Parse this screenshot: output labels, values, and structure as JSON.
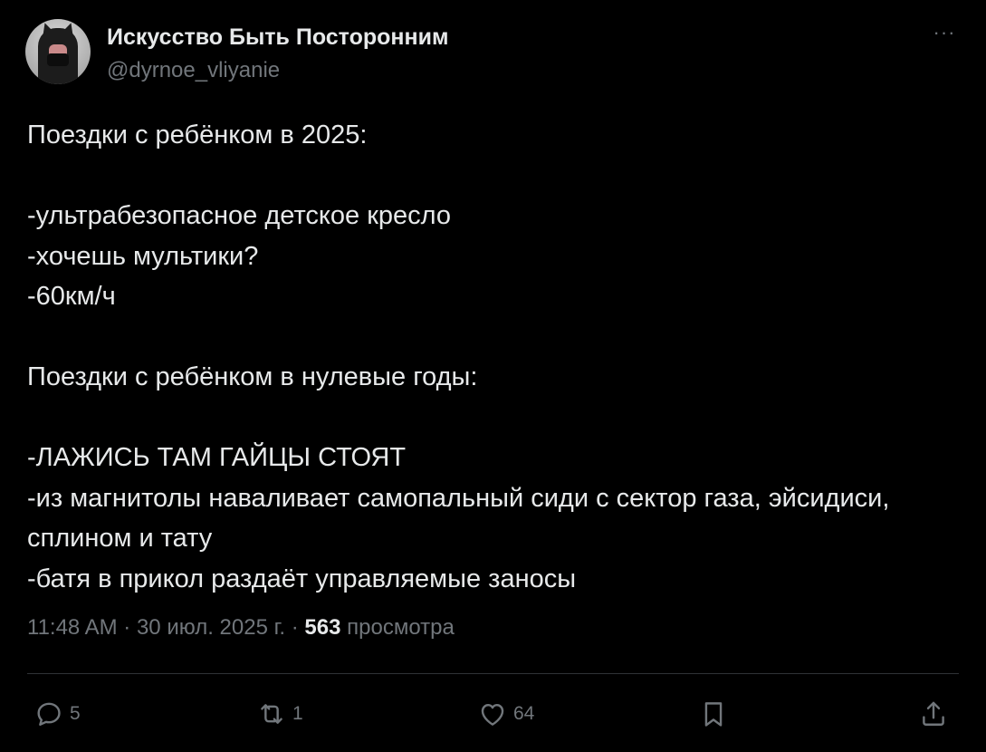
{
  "author": {
    "display_name": "Искусство Быть Посторонним",
    "handle": "@dyrnoe_vliyanie"
  },
  "more_icon": "more-horizontal-icon",
  "tweet_text": [
    "Поездки с ребёнком в 2025:",
    "",
    "-ультрабезопасное детское кресло",
    "-хочешь мультики?",
    "-60км/ч",
    "",
    "Поездки с ребёнком в нулевые годы:",
    "",
    "-ЛАЖИСЬ ТАМ ГАЙЦЫ СТОЯТ",
    "-из магнитолы наваливает самопальный сиди с сектор газа, эйсидиси,",
    "сплином и тату",
    "-батя в прикол раздаёт управляемые заносы"
  ],
  "meta": {
    "time": "11:48 AM",
    "separator": " · ",
    "date": "30 июл. 2025 г.",
    "views_count": "563",
    "views_label": "просмотра"
  },
  "actions": {
    "reply": {
      "icon": "reply-icon",
      "count": "5"
    },
    "retweet": {
      "icon": "retweet-icon",
      "count": "1"
    },
    "like": {
      "icon": "heart-icon",
      "count": "64"
    },
    "bookmark": {
      "icon": "bookmark-icon"
    },
    "share": {
      "icon": "share-icon"
    }
  },
  "colors": {
    "background": "#000000",
    "text_primary": "#e7e9ea",
    "text_secondary": "#71767b",
    "divider": "#2f3336"
  }
}
